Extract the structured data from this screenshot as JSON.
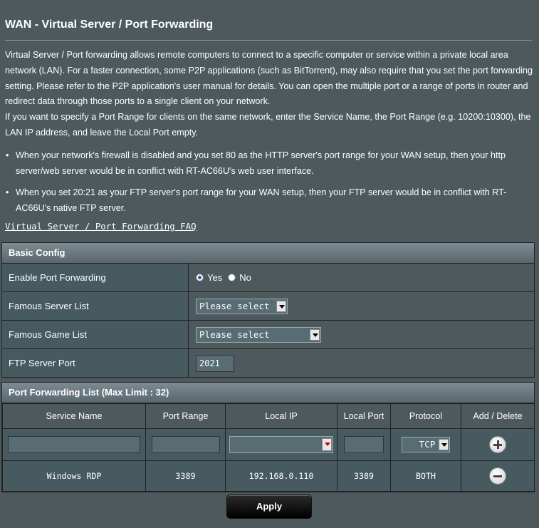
{
  "page": {
    "title": "WAN - Virtual Server / Port Forwarding",
    "intro": [
      "Virtual Server / Port forwarding allows remote computers to connect to a specific computer or service within a private local area network (LAN). For a faster connection, some P2P applications (such as BitTorrent), may also require that you set the port forwarding setting. Please refer to the P2P application's user manual for details. You can open the multiple port or a range of ports in router and redirect data through those ports to a single client on your network.",
      "If you want to specify a Port Range for clients on the same network, enter the Service Name, the Port Range (e.g. 10200:10300), the LAN IP address, and leave the Local Port empty."
    ],
    "bullets": [
      "When your network's firewall is disabled and you set 80 as the HTTP server's port range for your WAN setup, then your http server/web server would be in conflict with RT-AC66U's web user interface.",
      "When you set 20:21 as your FTP server's port range for your WAN setup, then your FTP server would be in conflict with RT-AC66U's native FTP server."
    ],
    "faq_link": "Virtual Server / Port Forwarding FAQ"
  },
  "basic_config": {
    "header": "Basic Config",
    "enable_label": "Enable Port Forwarding",
    "yes_label": "Yes",
    "no_label": "No",
    "enabled": "Yes",
    "famous_server_label": "Famous Server List",
    "famous_server_value": "Please select",
    "famous_game_label": "Famous Game List",
    "famous_game_value": "Please select",
    "ftp_port_label": "FTP Server Port",
    "ftp_port_value": "2021"
  },
  "pf_list": {
    "header": "Port Forwarding List (Max Limit : 32)",
    "columns": [
      "Service Name",
      "Port Range",
      "Local IP",
      "Local Port",
      "Protocol",
      "Add / Delete"
    ],
    "new_protocol": "TCP",
    "rows": [
      {
        "service": "Windows RDP",
        "port_range": "3389",
        "local_ip": "192.168.0.110",
        "local_port": "3389",
        "protocol": "BOTH"
      }
    ]
  },
  "apply_label": "Apply",
  "colors": {
    "background": "#4d595d",
    "label_bg": "#475a5f",
    "header_gradient": "#7c8c93"
  }
}
